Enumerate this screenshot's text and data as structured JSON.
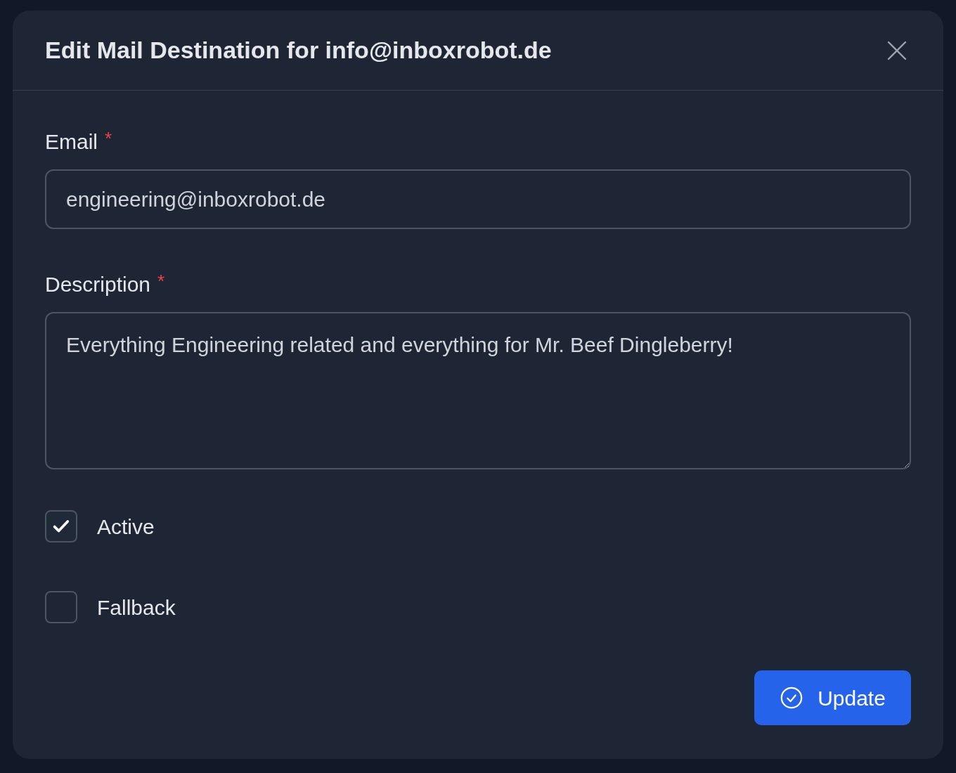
{
  "dialog": {
    "title": "Edit Mail Destination for info@inboxrobot.de"
  },
  "fields": [
    {
      "kind": "input",
      "label": "Email",
      "required_mark": "*",
      "value": "engineering@inboxrobot.de"
    },
    {
      "kind": "textarea",
      "label": "Description",
      "required_mark": "*",
      "value": "Everything Engineering related and everything for Mr. Beef Dingleberry!"
    }
  ],
  "checkboxes": [
    {
      "label": "Active",
      "checked": true
    },
    {
      "label": "Fallback",
      "checked": false
    }
  ],
  "submit_button": {
    "label": "Update"
  }
}
